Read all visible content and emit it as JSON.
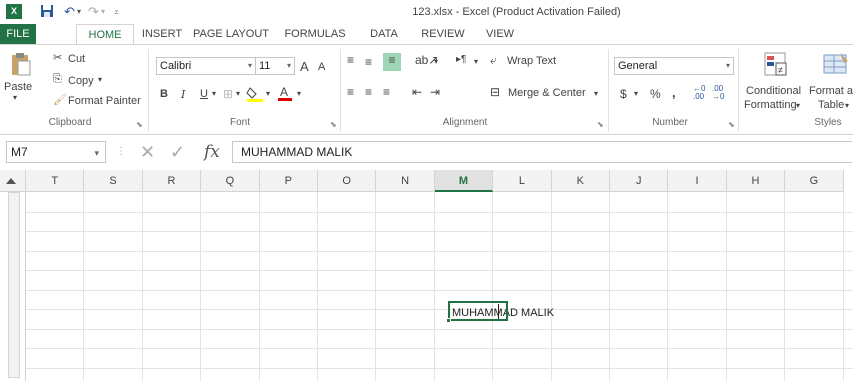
{
  "app": {
    "title": "123.xlsx - Excel (Product Activation Failed)",
    "logo_text": "X",
    "accent": "#217346"
  },
  "qat": {
    "save_icon": "save-icon",
    "undo_icon": "undo-icon",
    "redo_icon": "redo-icon",
    "customize_icon": "customize-qat-icon"
  },
  "tabs": [
    "FILE",
    "HOME",
    "INSERT",
    "PAGE LAYOUT",
    "FORMULAS",
    "DATA",
    "REVIEW",
    "VIEW"
  ],
  "ribbon": {
    "clipboard": {
      "paste": "Paste",
      "cut": "Cut",
      "copy": "Copy",
      "format_painter": "Format Painter",
      "label": "Clipboard"
    },
    "font": {
      "family": "Calibri",
      "size": "11",
      "bold": "B",
      "italic": "I",
      "underline": "U",
      "grow": "A",
      "shrink": "A",
      "label": "Font"
    },
    "alignment": {
      "wrap_text": "Wrap Text",
      "merge_center": "Merge & Center",
      "label": "Alignment"
    },
    "number": {
      "format": "General",
      "currency": "$",
      "percent": "%",
      "comma": ",",
      "inc_decimal": "←0\n.00",
      "dec_decimal": ".00\n→0",
      "label": "Number"
    },
    "styles": {
      "conditional": "Conditional",
      "formatting": "Formatting",
      "format_as": "Format a",
      "table": "Table",
      "label": "Styles"
    }
  },
  "formula_bar": {
    "name_box": "M7",
    "fx": "fx",
    "value": "MUHAMMAD MALIK"
  },
  "grid": {
    "columns": [
      "T",
      "S",
      "R",
      "Q",
      "P",
      "O",
      "N",
      "M",
      "L",
      "K",
      "J",
      "I",
      "H",
      "G"
    ],
    "selected_column": "M",
    "active_cell_text": "MUHAMMAD MALIK"
  }
}
